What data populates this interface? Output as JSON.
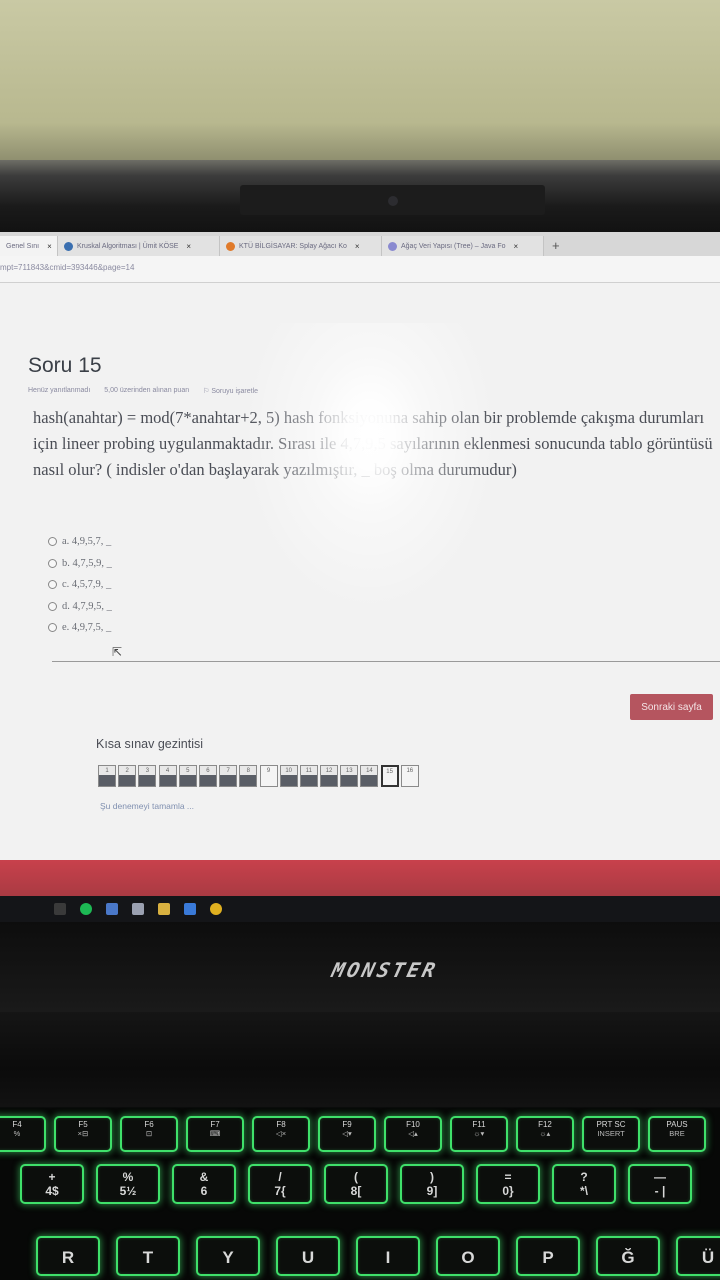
{
  "browser": {
    "tabs": [
      {
        "label": "Genel Sını",
        "color": "#f0f0f0",
        "active": true
      },
      {
        "label": "Kruskal Algoritması | Ümit KÖSE",
        "color": "#3a6fb0",
        "active": false
      },
      {
        "label": "KTÜ BİLGİSAYAR: Splay Ağacı Ko",
        "color": "#e07a2a",
        "active": false
      },
      {
        "label": "Ağaç Veri Yapısı (Tree) – Java Fo",
        "color": "#8a8ad0",
        "active": false
      }
    ],
    "tab_close": "×",
    "new_tab": "+",
    "url": "mpt=711843&cmid=393446&page=14"
  },
  "question": {
    "title": "Soru 15",
    "meta_status": "Henüz yanıtlanmadı",
    "meta_points": "5,00 üzerinden alınan puan",
    "meta_flag": "Soruyu işaretle",
    "text": "hash(anahtar) = mod(7*anahtar+2, 5) hash fonksiyonuna sahip olan bir problemde çakışma durumları için lineer probing uygulanmaktadır. Sırası ile 4,7,9,5 sayılarının eklenmesi sonucunda tablo görüntüsü nasıl olur? ( indisler o'dan başlayarak yazılmıştır, _ boş olma durumudur)",
    "options": [
      {
        "label": "a. 4,9,5,7, _"
      },
      {
        "label": "b. 4,7,5,9, _"
      },
      {
        "label": "c. 4,5,7,9, _"
      },
      {
        "label": "d. 4,7,9,5, _"
      },
      {
        "label": "e. 4,9,7,5, _"
      }
    ]
  },
  "navigation": {
    "next_label": "Sonraki sayfa",
    "nav_title": "Kısa sınav gezintisi",
    "cells": [
      {
        "num": "1",
        "state": "answered"
      },
      {
        "num": "2",
        "state": "answered"
      },
      {
        "num": "3",
        "state": "answered"
      },
      {
        "num": "4",
        "state": "answered"
      },
      {
        "num": "5",
        "state": "answered"
      },
      {
        "num": "6",
        "state": "answered"
      },
      {
        "num": "7",
        "state": "answered"
      },
      {
        "num": "8",
        "state": "answered"
      },
      {
        "num": "9",
        "state": "unanswered"
      },
      {
        "num": "10",
        "state": "answered"
      },
      {
        "num": "11",
        "state": "answered"
      },
      {
        "num": "12",
        "state": "answered"
      },
      {
        "num": "13",
        "state": "answered"
      },
      {
        "num": "14",
        "state": "answered"
      },
      {
        "num": "15",
        "state": "current"
      },
      {
        "num": "16",
        "state": "unanswered"
      }
    ],
    "finish_label": "Şu denemeyi tamamla ..."
  },
  "laptop": {
    "brand": "MONSTER",
    "fkeys": [
      {
        "top": "F4",
        "sub": "%"
      },
      {
        "top": "F5",
        "sub": "×⊟"
      },
      {
        "top": "F6",
        "sub": "⊡"
      },
      {
        "top": "F7",
        "sub": "⌨"
      },
      {
        "top": "F8",
        "sub": "◁×"
      },
      {
        "top": "F9",
        "sub": "◁▾"
      },
      {
        "top": "F10",
        "sub": "◁▴"
      },
      {
        "top": "F11",
        "sub": "☼▾"
      },
      {
        "top": "F12",
        "sub": "☼▴"
      },
      {
        "top": "PRT SC",
        "sub": "INSERT"
      },
      {
        "top": "PAUS",
        "sub": "BRE"
      }
    ],
    "numkeys": [
      {
        "top": "+",
        "sub": "4$"
      },
      {
        "top": "%",
        "sub": "5½"
      },
      {
        "top": "&",
        "sub": "6"
      },
      {
        "top": "/",
        "sub": "7{"
      },
      {
        "top": "(",
        "sub": "8["
      },
      {
        "top": ")",
        "sub": "9]"
      },
      {
        "top": "=",
        "sub": "0}"
      },
      {
        "top": "?",
        "sub": "*\\"
      },
      {
        "top": "—",
        "sub": "- |"
      }
    ],
    "letterkeys": [
      "R",
      "T",
      "Y",
      "U",
      "I",
      "O",
      "P",
      "Ğ",
      "Ü"
    ]
  }
}
